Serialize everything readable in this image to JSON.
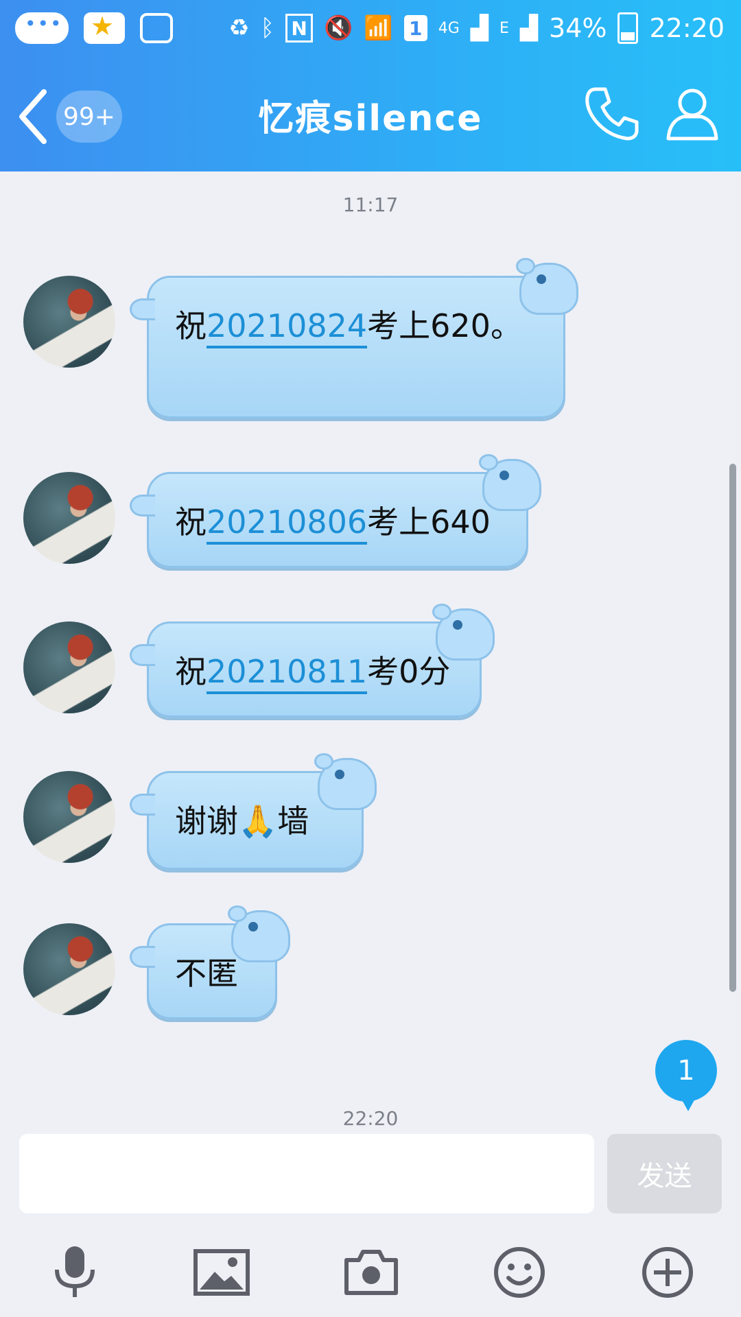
{
  "status_bar": {
    "network": "4G",
    "network2": "E",
    "sim": "1",
    "nfc": "N",
    "battery": "34%",
    "time": "22:20"
  },
  "nav": {
    "unread_badge": "99+",
    "title": "忆痕silence"
  },
  "chat": {
    "time_top": "11:17",
    "messages": [
      {
        "pre": "祝",
        "num": "20210824",
        "post": "考上620。"
      },
      {
        "pre": "祝",
        "num": "20210806",
        "post": "考上640"
      },
      {
        "pre": "祝",
        "num": "20210811",
        "post": "考0分"
      },
      {
        "pre": "谢谢",
        "emoji": "🙏",
        "post": "墙"
      },
      {
        "pre": "不匿"
      }
    ],
    "time_bottom": "22:20",
    "new_message_count": "1"
  },
  "composer": {
    "input_value": "",
    "send_label": "发送"
  },
  "colors": {
    "header_start": "#3d8ff0",
    "header_end": "#27bff8",
    "bubble": "#b7defa",
    "link": "#1c8fd6"
  },
  "icons": [
    "back-chevron-icon",
    "phone-icon",
    "profile-icon",
    "microphone-icon",
    "image-icon",
    "camera-icon",
    "emoji-icon",
    "plus-icon"
  ]
}
